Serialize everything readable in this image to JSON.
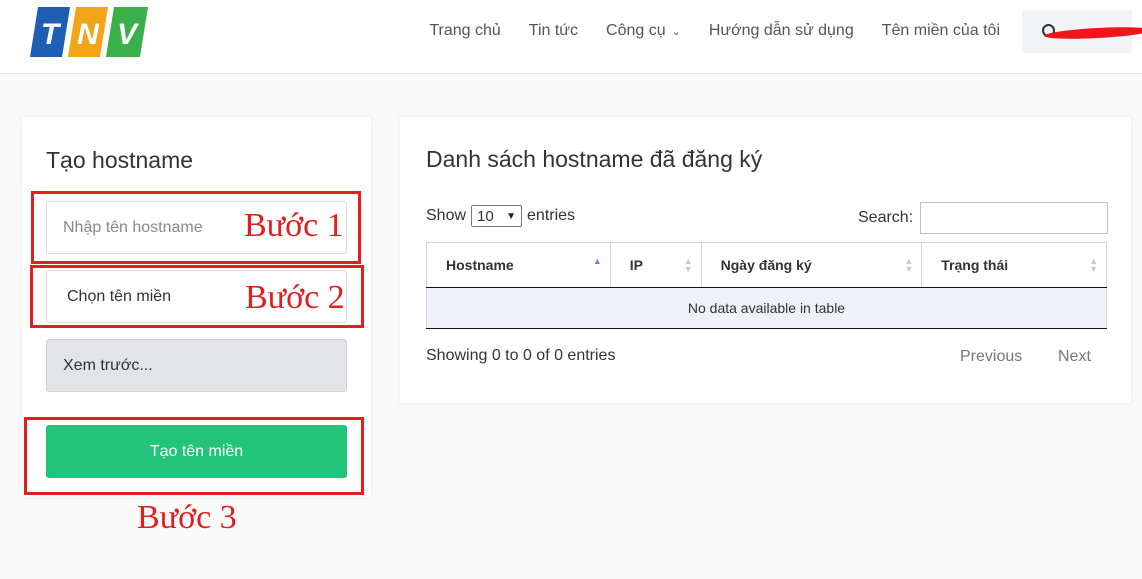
{
  "brand": {
    "logo_letters": [
      "T",
      "N",
      "V"
    ],
    "colors": {
      "t": "#1e5fb4",
      "n": "#f2a516",
      "v": "#39b04a"
    }
  },
  "nav": {
    "items": [
      {
        "label": "Trang chủ"
      },
      {
        "label": "Tin tức"
      },
      {
        "label": "Công cụ",
        "has_dropdown": true
      },
      {
        "label": "Hướng dẫn sử dụng"
      },
      {
        "label": "Tên miền của tôi"
      }
    ]
  },
  "create_card": {
    "title": "Tạo hostname",
    "hostname_placeholder": "Nhập tên hostname",
    "domain_select_value": "Chọn tên miền",
    "preview_value": "Xem trước...",
    "submit_label": "Tạo tên miền"
  },
  "annotations": {
    "step1": "Bước 1",
    "step2": "Bước 2",
    "step3": "Bước 3",
    "color": "#e21e1e"
  },
  "list_card": {
    "title": "Danh sách hostname đã đăng ký",
    "show_label": "Show",
    "entries_value": "10",
    "entries_label": "entries",
    "search_label": "Search:",
    "columns": [
      "Hostname",
      "IP",
      "Ngày đăng ký",
      "Trạng thái"
    ],
    "empty_message": "No data available in table",
    "showing_text": "Showing 0 to 0 of 0 entries",
    "previous_label": "Previous",
    "next_label": "Next"
  },
  "accent_green": "#22c47a"
}
